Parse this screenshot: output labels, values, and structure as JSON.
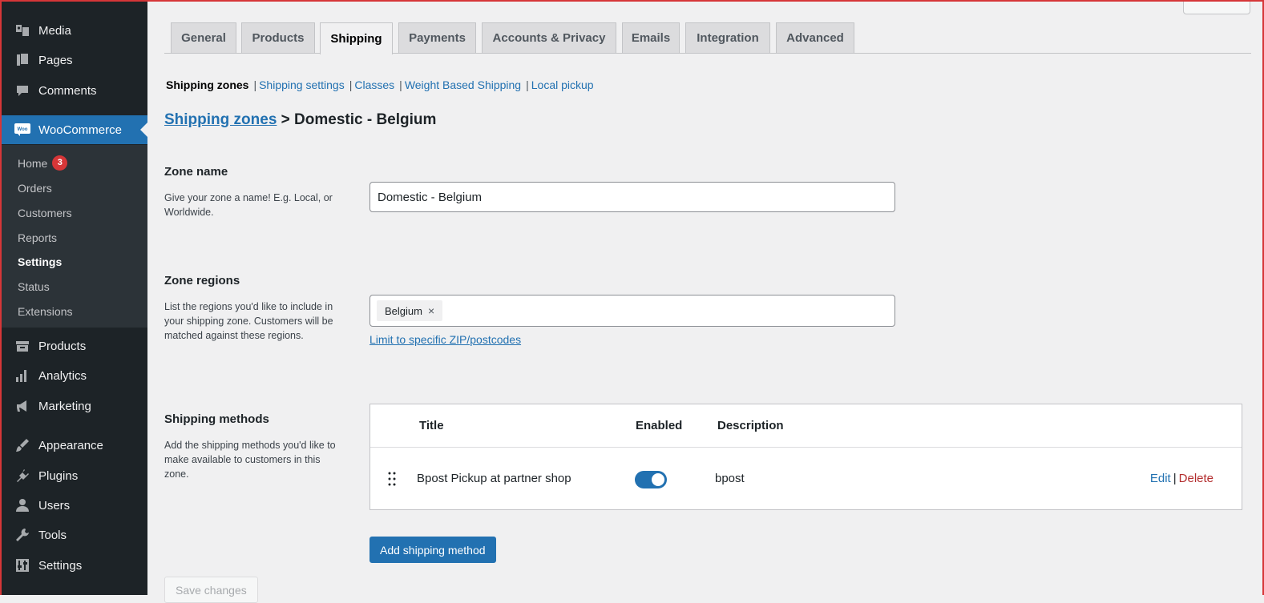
{
  "sidebar": {
    "top_items": [
      {
        "label": "Media",
        "icon": "media-icon"
      },
      {
        "label": "Pages",
        "icon": "pages-icon"
      },
      {
        "label": "Comments",
        "icon": "comments-icon"
      }
    ],
    "woocommerce": {
      "label": "WooCommerce",
      "icon": "woo-icon",
      "logo_text": "Woo"
    },
    "submenu": [
      {
        "label": "Home",
        "badge": "3"
      },
      {
        "label": "Orders"
      },
      {
        "label": "Customers"
      },
      {
        "label": "Reports"
      },
      {
        "label": "Settings",
        "current": true
      },
      {
        "label": "Status"
      },
      {
        "label": "Extensions"
      }
    ],
    "bottom_items": [
      {
        "label": "Products",
        "icon": "products-icon"
      },
      {
        "label": "Analytics",
        "icon": "analytics-icon"
      },
      {
        "label": "Marketing",
        "icon": "marketing-icon"
      },
      {
        "label": "Appearance",
        "icon": "appearance-icon"
      },
      {
        "label": "Plugins",
        "icon": "plugins-icon"
      },
      {
        "label": "Users",
        "icon": "users-icon"
      },
      {
        "label": "Tools",
        "icon": "tools-icon"
      },
      {
        "label": "Settings",
        "icon": "settings-icon"
      }
    ]
  },
  "tabs": [
    {
      "label": "General"
    },
    {
      "label": "Products"
    },
    {
      "label": "Shipping",
      "active": true
    },
    {
      "label": "Payments"
    },
    {
      "label": "Accounts & Privacy"
    },
    {
      "label": "Emails"
    },
    {
      "label": "Integration"
    },
    {
      "label": "Advanced"
    }
  ],
  "subnav": {
    "current": "Shipping zones",
    "links": [
      "Shipping settings",
      "Classes",
      "Weight Based Shipping",
      "Local pickup"
    ],
    "separator": "|"
  },
  "breadcrumb": {
    "link": "Shipping zones",
    "rest": "> Domestic - Belgium"
  },
  "zone_name": {
    "title": "Zone name",
    "description": "Give your zone a name! E.g. Local, or Worldwide.",
    "value": "Domestic - Belgium"
  },
  "zone_regions": {
    "title": "Zone regions",
    "description": "List the regions you'd like to include in your shipping zone. Customers will be matched against these regions.",
    "selected": "Belgium",
    "remove_glyph": "×",
    "limit_link": "Limit to specific ZIP/postcodes"
  },
  "shipping_methods": {
    "title": "Shipping methods",
    "description": "Add the shipping methods you'd like to make available to customers in this zone.",
    "columns": {
      "title": "Title",
      "enabled": "Enabled",
      "description": "Description"
    },
    "rows": [
      {
        "title": "Bpost Pickup at partner shop",
        "enabled": true,
        "description": "bpost",
        "edit": "Edit",
        "separator": "|",
        "delete": "Delete"
      }
    ],
    "add_button": "Add shipping method"
  },
  "save_button": "Save changes",
  "colors": {
    "sidebar_bg": "#1d2327",
    "accent": "#2271b1",
    "delete": "#b32d2e",
    "badge": "#d63638"
  }
}
